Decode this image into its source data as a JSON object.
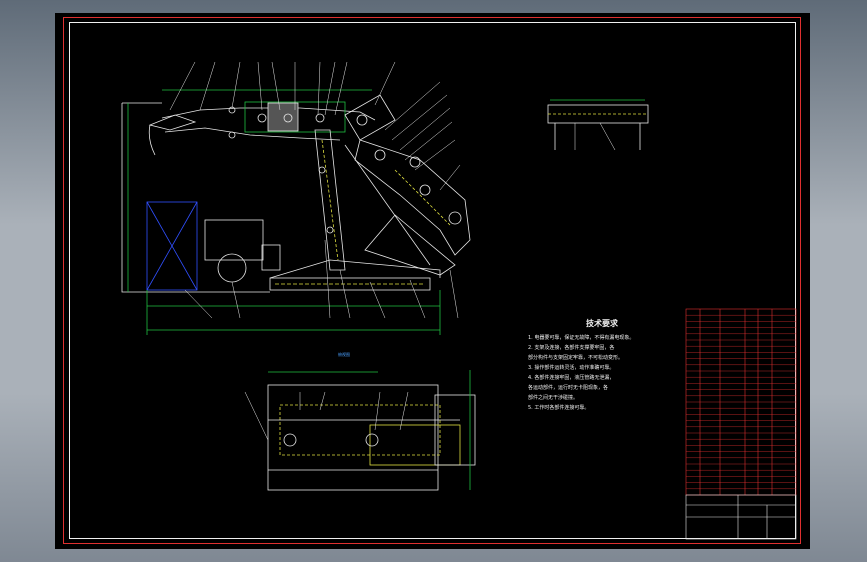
{
  "drawing": {
    "notes_title": "技术要求",
    "notes": [
      "1. 电器要可靠，保证无故障，不得有漏电现象。",
      "2. 支架及连接，各部件支撑要牢固，各",
      "   部分构件与支架固定牢靠，不可松动变形。",
      "3. 操作部件运转灵活，动作准确可靠。",
      "4. 各部件连接牢固，液压管路无泄漏，",
      "   各运动部件，运行时无卡阻现象，各",
      "   部件之间无干涉碰撞。",
      "5. 工作时各部件连接可靠。"
    ],
    "plan_view_label": "俯视图",
    "colors": {
      "sheet": "#000000",
      "frame": "#e03030",
      "outline": "#f0f0f0",
      "machine": "#e8e8e8",
      "dimension": "#20c040",
      "hidden": "#e0e040",
      "cylinder_block": "#3050ff",
      "leader": "#f0f0f0"
    }
  }
}
